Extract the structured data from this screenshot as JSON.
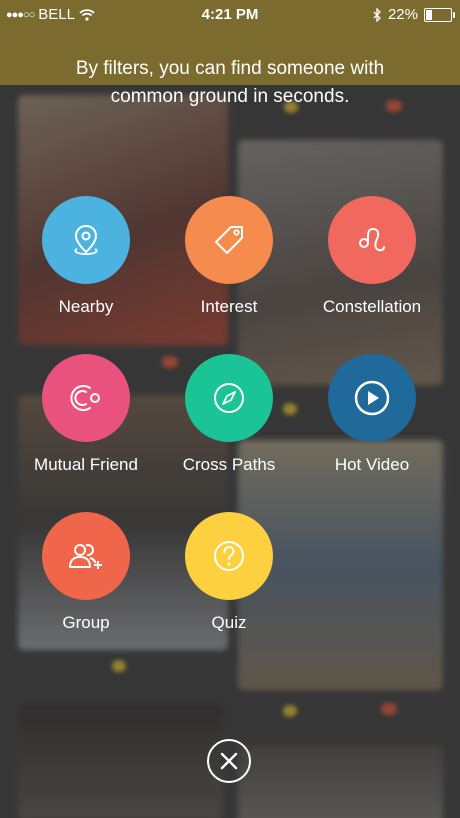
{
  "status_bar": {
    "carrier": "BELL",
    "time": "4:21 PM",
    "battery_text": "22%",
    "battery_level": 0.22
  },
  "headline": "By filters, you can find someone with common ground in seconds.",
  "filters": [
    {
      "label": "Nearby",
      "color": "#4cb3e0",
      "icon": "location-pin-icon"
    },
    {
      "label": "Interest",
      "color": "#f58b4c",
      "icon": "tag-icon"
    },
    {
      "label": "Constellation",
      "color": "#f1685e",
      "icon": "leo-zodiac-icon"
    },
    {
      "label": "Mutual Friend",
      "color": "#e8527c",
      "icon": "mutual-friend-icon"
    },
    {
      "label": "Cross Paths",
      "color": "#1bc497",
      "icon": "compass-icon"
    },
    {
      "label": "Hot Video",
      "color": "#20699b",
      "icon": "play-icon"
    },
    {
      "label": "Group",
      "color": "#f0664a",
      "icon": "group-add-icon"
    },
    {
      "label": "Quiz",
      "color": "#fcd03e",
      "icon": "question-icon"
    }
  ],
  "close_icon": "close-icon"
}
